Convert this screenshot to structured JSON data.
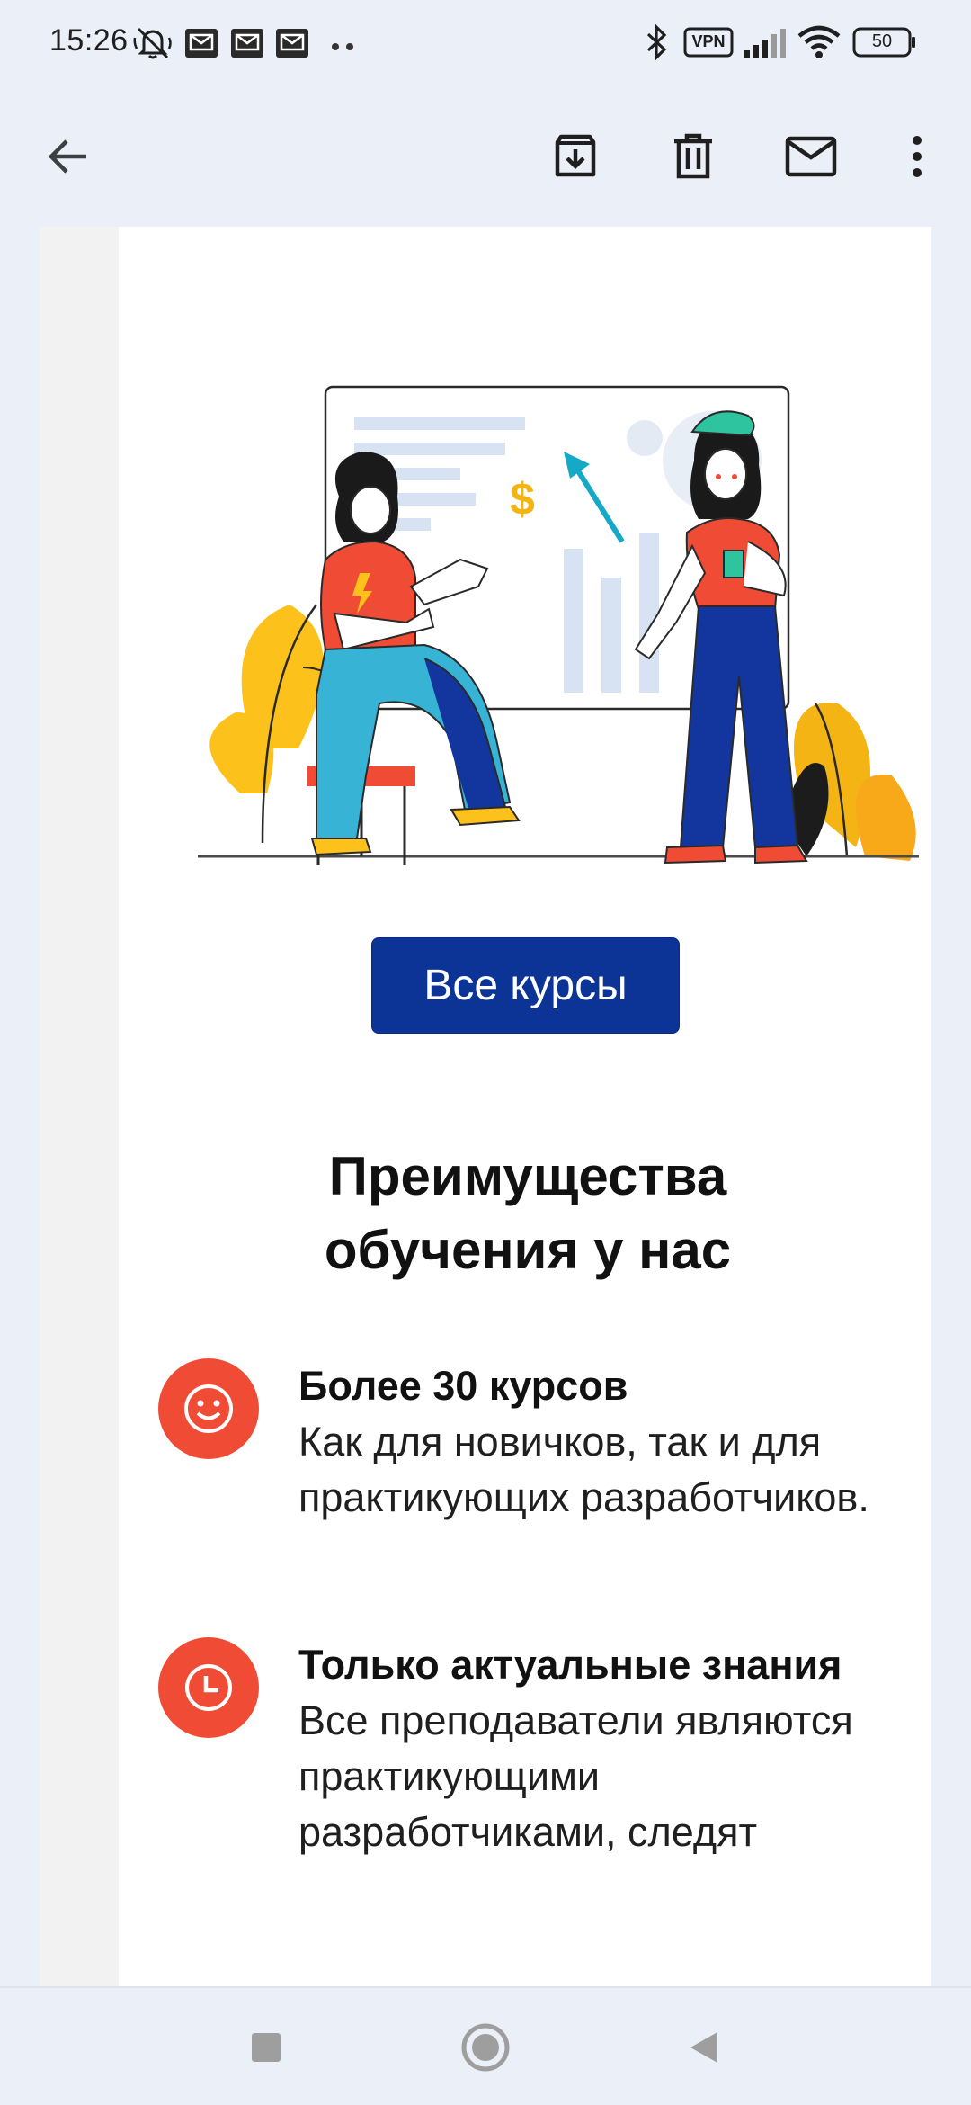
{
  "status_bar": {
    "time": "15:26",
    "vpn_label": "VPN",
    "battery_level": "50",
    "icons": [
      "mute-icon",
      "mail-notification-icon",
      "mail-notification-icon",
      "mail-notification-icon",
      "more-dots-icon",
      "bluetooth-icon",
      "vpn-icon",
      "signal-icon",
      "wifi-icon",
      "battery-icon"
    ]
  },
  "app_bar": {
    "actions": [
      "back-arrow-icon",
      "archive-icon",
      "delete-icon",
      "mark-unread-icon",
      "more-options-icon"
    ]
  },
  "email": {
    "button_label": "Все курсы",
    "benefits_title": "Преимущества обучения у нас",
    "benefits": [
      {
        "icon": "smiley-icon",
        "title": "Более 30 курсов",
        "description": "Как для новичков, так и для практикующих разработчиков."
      },
      {
        "icon": "clock-icon",
        "title": "Только актуальные знания",
        "description": "Все преподаватели являются практикующими разработчиками, следят"
      }
    ]
  },
  "colors": {
    "primary_button": "#0c3396",
    "benefit_icon_bg": "#f04b34",
    "background": "#ebf0f8"
  },
  "nav_bar": {
    "buttons": [
      "recents-square-icon",
      "home-circle-icon",
      "back-triangle-icon"
    ]
  }
}
